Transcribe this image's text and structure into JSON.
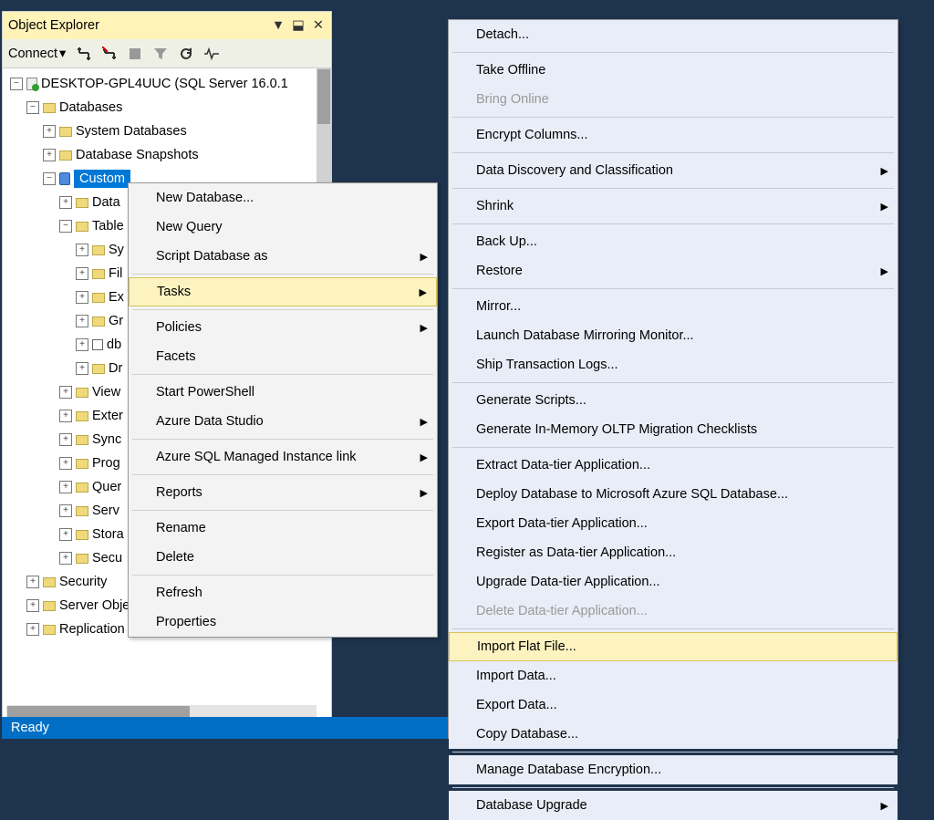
{
  "panel": {
    "title": "Object Explorer",
    "icons": {
      "dropdown": "▼",
      "pin": "⬓",
      "close": "✕"
    }
  },
  "toolbar": {
    "connect_label": "Connect",
    "dropdown_glyph": "▾"
  },
  "tree": {
    "server": "DESKTOP-GPL4UUC (SQL Server 16.0.1",
    "databases": "Databases",
    "system_databases": "System Databases",
    "database_snapshots": "Database Snapshots",
    "selected_db": "Custom",
    "data": "Data",
    "tables": "Table",
    "sy": "Sy",
    "fil": "Fil",
    "ex": "Ex",
    "gr": "Gr",
    "db": "db",
    "dr": "Dr",
    "views": "View",
    "exter": "Exter",
    "sync": "Sync",
    "prog": "Prog",
    "quer": "Quer",
    "serv": "Serv",
    "stora": "Stora",
    "secu": "Secu",
    "security": "Security",
    "server_objects": "Server Objects",
    "replication": "Replication"
  },
  "context_menu_1": [
    {
      "label": "New Database..."
    },
    {
      "label": "New Query"
    },
    {
      "label": "Script Database as",
      "submenu": true
    },
    {
      "sep": true
    },
    {
      "label": "Tasks",
      "submenu": true,
      "highlight": true
    },
    {
      "sep": true
    },
    {
      "label": "Policies",
      "submenu": true
    },
    {
      "label": "Facets"
    },
    {
      "sep": true
    },
    {
      "label": "Start PowerShell"
    },
    {
      "label": "Azure Data Studio",
      "submenu": true
    },
    {
      "sep": true
    },
    {
      "label": "Azure SQL Managed Instance link",
      "submenu": true
    },
    {
      "sep": true
    },
    {
      "label": "Reports",
      "submenu": true
    },
    {
      "sep": true
    },
    {
      "label": "Rename"
    },
    {
      "label": "Delete"
    },
    {
      "sep": true
    },
    {
      "label": "Refresh"
    },
    {
      "label": "Properties"
    }
  ],
  "context_menu_2": [
    {
      "label": "Detach..."
    },
    {
      "sep": true
    },
    {
      "label": "Take Offline"
    },
    {
      "label": "Bring Online",
      "disabled": true
    },
    {
      "sep": true
    },
    {
      "label": "Encrypt Columns..."
    },
    {
      "sep": true
    },
    {
      "label": "Data Discovery and Classification",
      "submenu": true
    },
    {
      "sep": true
    },
    {
      "label": "Shrink",
      "submenu": true
    },
    {
      "sep": true
    },
    {
      "label": "Back Up..."
    },
    {
      "label": "Restore",
      "submenu": true
    },
    {
      "sep": true
    },
    {
      "label": "Mirror..."
    },
    {
      "label": "Launch Database Mirroring Monitor..."
    },
    {
      "label": "Ship Transaction Logs..."
    },
    {
      "sep": true
    },
    {
      "label": "Generate Scripts..."
    },
    {
      "label": "Generate In-Memory OLTP Migration Checklists"
    },
    {
      "sep": true
    },
    {
      "label": "Extract Data-tier Application..."
    },
    {
      "label": "Deploy Database to Microsoft Azure SQL Database..."
    },
    {
      "label": "Export Data-tier Application..."
    },
    {
      "label": "Register as Data-tier Application..."
    },
    {
      "label": "Upgrade Data-tier Application..."
    },
    {
      "label": "Delete Data-tier Application...",
      "disabled": true
    },
    {
      "sep": true
    },
    {
      "label": "Import Flat File...",
      "highlight": true
    },
    {
      "label": "Import Data..."
    },
    {
      "label": "Export Data..."
    },
    {
      "label": "Copy Database..."
    },
    {
      "sep": true
    },
    {
      "label": "Manage Database Encryption..."
    },
    {
      "sep": true
    },
    {
      "label": "Database Upgrade",
      "submenu": true
    }
  ],
  "status": "Ready"
}
